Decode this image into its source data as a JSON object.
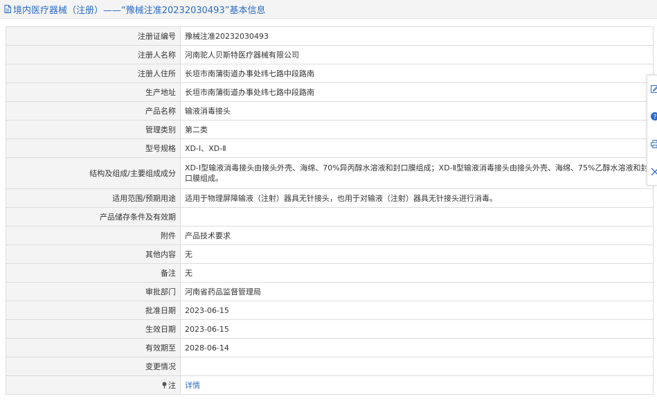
{
  "title": "境内医疗器械（注册）——“豫械注准20232030493”基本信息",
  "rows": [
    {
      "label": "注册证编号",
      "value": "豫械注准20232030493"
    },
    {
      "label": "注册人名称",
      "value": "河南驼人贝斯特医疗器械有限公司"
    },
    {
      "label": "注册人住所",
      "value": "长垣市南蒲街道办事处纬七路中段路南"
    },
    {
      "label": "生产地址",
      "value": "长垣市南蒲街道办事处纬七路中段路南"
    },
    {
      "label": "产品名称",
      "value": "输液消毒接头"
    },
    {
      "label": "管理类别",
      "value": "第二类"
    },
    {
      "label": "型号规格",
      "value": "XD-Ⅰ、XD-Ⅱ"
    },
    {
      "label": "结构及组成/主要组成成分",
      "value": "XD-Ⅰ型输液消毒接头由接头外壳、海绵、70%异丙醇水溶液和封口膜组成；XD-Ⅱ型输液消毒接头由接头外壳、海绵、75%乙醇水溶液和封口膜组成。"
    },
    {
      "label": "适用范围/预期用途",
      "value": "适用于物理屏障输液（注射）器具无针接头，也用于对输液（注射）器具无针接头进行消毒。"
    },
    {
      "label": "产品储存条件及有效期",
      "value": ""
    },
    {
      "label": "附件",
      "value": "产品技术要求"
    },
    {
      "label": "其他内容",
      "value": "无"
    },
    {
      "label": "备注",
      "value": "无"
    },
    {
      "label": "审批部门",
      "value": "河南省药品监督管理局"
    },
    {
      "label": "批准日期",
      "value": "2023-06-15"
    },
    {
      "label": "生效日期",
      "value": "2023-06-15"
    },
    {
      "label": "有效期至",
      "value": "2028-06-14"
    },
    {
      "label": "变更情况",
      "value": ""
    }
  ],
  "note": {
    "label": "注",
    "link": "详情"
  },
  "side_tools": [
    "edit-icon",
    "help-icon",
    "print-icon",
    "close-icon"
  ],
  "colors": {
    "link": "#2b6cc4",
    "label_bg": "#f4f4f4",
    "border": "#dcdcdc",
    "help_bg": "#2b6cc4"
  }
}
